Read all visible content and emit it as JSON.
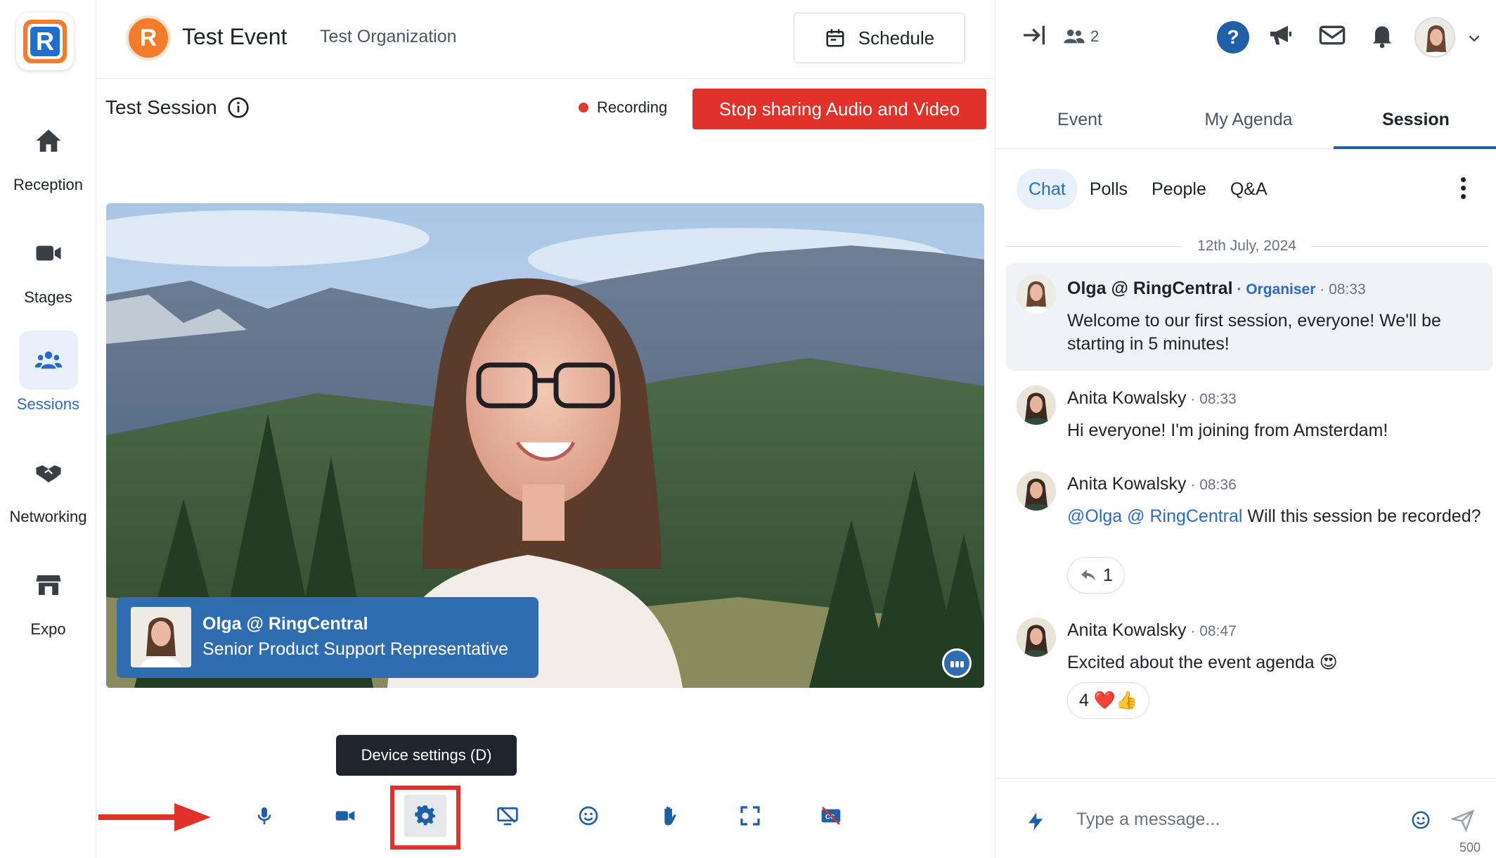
{
  "app": {
    "logo_letter": "R",
    "event_title": "Test Event",
    "organization": "Test Organization",
    "schedule_label": "Schedule"
  },
  "nav": [
    {
      "label": "Reception",
      "icon": "home-icon"
    },
    {
      "label": "Stages",
      "icon": "video-camera-icon"
    },
    {
      "label": "Sessions",
      "icon": "people-group-icon",
      "active": true
    },
    {
      "label": "Networking",
      "icon": "handshake-icon"
    },
    {
      "label": "Expo",
      "icon": "store-icon"
    }
  ],
  "session": {
    "title": "Test Session",
    "recording_label": "Recording",
    "stop_button": "Stop sharing Audio and Video",
    "speaker_name": "Olga @ RingCentral",
    "speaker_title": "Senior Product Support Representative",
    "tooltip": "Device settings (D)"
  },
  "controls": [
    "microphone-icon",
    "camera-icon",
    "gear-icon",
    "screen-share-off-icon",
    "emoji-icon",
    "raise-hand-icon",
    "fullscreen-icon",
    "captions-off-icon"
  ],
  "rightpanel": {
    "attendee_count": "2",
    "help_label": "?",
    "tabs": [
      "Event",
      "My Agenda",
      "Session"
    ],
    "active_tab": "Session",
    "subtabs": [
      "Chat",
      "Polls",
      "People",
      "Q&A"
    ],
    "date": "12th July, 2024",
    "messages": [
      {
        "author": "Olga @ RingCentral",
        "role": "Organiser",
        "time": "08:33",
        "text": "Welcome to our first session, everyone! We'll be starting in 5 minutes!"
      },
      {
        "author": "Anita Kowalsky",
        "time": "08:33",
        "text": "Hi everyone! I'm joining from Amsterdam!"
      },
      {
        "author": "Anita Kowalsky",
        "time": "08:36",
        "mention": "@Olga @ RingCentral",
        "text": " Will this session be recorded?",
        "reaction": "1"
      },
      {
        "author": "Anita Kowalsky",
        "time": "08:47",
        "text": "Excited about the event agenda 😍",
        "reaction": "4 ❤️👍"
      }
    ],
    "composer_placeholder": "Type a message...",
    "char_limit": "500"
  },
  "colors": {
    "accent": "#1f5fa8",
    "brand_orange": "#f47b2a",
    "danger": "#e0322b",
    "link": "#2a6bc9"
  }
}
